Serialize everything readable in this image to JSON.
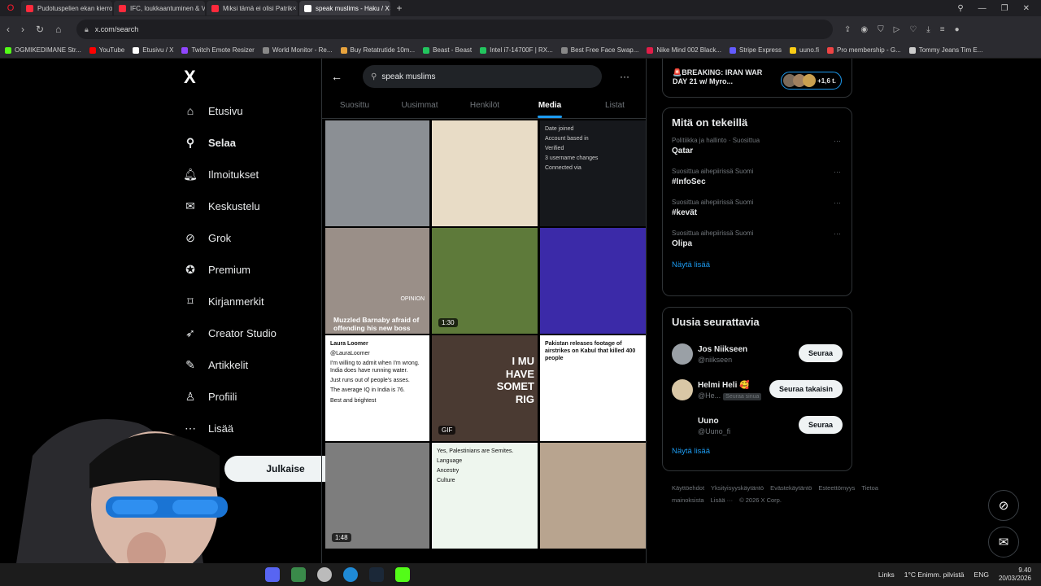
{
  "browser": {
    "tabs": [
      {
        "title": "Pudotuspelien ekan kierro",
        "color": "#ff2a3c"
      },
      {
        "title": "IFC, loukkaantuminen & V",
        "color": "#ff2a3c"
      },
      {
        "title": "Miksi tämä ei olisi Patrik",
        "color": "#ff2a3c"
      },
      {
        "title": "speak muslims - Haku / X",
        "color": "#ffffff",
        "active": true
      }
    ],
    "url": "x.com/search",
    "bookmarks": [
      {
        "label": "OGMIKEDIMANE Str...",
        "color": "#53fc18"
      },
      {
        "label": "YouTube",
        "color": "#ff0000"
      },
      {
        "label": "Etusivu / X",
        "color": "#ffffff"
      },
      {
        "label": "Twitch Emote Resizer",
        "color": "#9146ff"
      },
      {
        "label": "World Monitor - Re...",
        "color": "#888888"
      },
      {
        "label": "Buy Retatrutide 10m...",
        "color": "#e8a33d"
      },
      {
        "label": "Beast - Beast",
        "color": "#22c55e"
      },
      {
        "label": "Intel i7-14700F | RX...",
        "color": "#22c55e"
      },
      {
        "label": "Best Free Face Swap...",
        "color": "#888888"
      },
      {
        "label": "Nike Mind 002 Black...",
        "color": "#e11d48"
      },
      {
        "label": "Stripe Express",
        "color": "#635bff"
      },
      {
        "label": "uuno.fi",
        "color": "#facc15"
      },
      {
        "label": "Pro membership - G...",
        "color": "#ef4444"
      },
      {
        "label": "Tommy Jeans Tim E...",
        "color": "#cccccc"
      }
    ]
  },
  "sidebar": {
    "logo": "X",
    "items": [
      {
        "label": "Etusivu",
        "icon": "home-icon",
        "glyph": "⌂"
      },
      {
        "label": "Selaa",
        "icon": "search-icon",
        "glyph": "⚲",
        "bold": true
      },
      {
        "label": "Ilmoitukset",
        "icon": "bell-icon",
        "glyph": "🔔︎"
      },
      {
        "label": "Keskustelu",
        "icon": "mail-icon",
        "glyph": "✉"
      },
      {
        "label": "Grok",
        "icon": "grok-icon",
        "glyph": "⊘"
      },
      {
        "label": "Premium",
        "icon": "verified-icon",
        "glyph": "✪"
      },
      {
        "label": "Kirjanmerkit",
        "icon": "bookmark-icon",
        "glyph": "⌑"
      },
      {
        "label": "Creator Studio",
        "icon": "rocket-icon",
        "glyph": "➶"
      },
      {
        "label": "Artikkelit",
        "icon": "article-icon",
        "glyph": "✎"
      },
      {
        "label": "Profiili",
        "icon": "person-icon",
        "glyph": "♙"
      },
      {
        "label": "Lisää",
        "icon": "more-icon",
        "glyph": "⋯"
      }
    ],
    "post_button": "Julkaise"
  },
  "search": {
    "query": "speak muslims",
    "tabs": [
      "Suosittu",
      "Uusimmat",
      "Henkilöt",
      "Media",
      "Listat"
    ],
    "active_tab": "Media"
  },
  "media_grid": [
    {
      "kind": "photo",
      "bg": "#8b8f94",
      "caption": ""
    },
    {
      "kind": "photo",
      "bg": "#e8dcc6",
      "caption": ""
    },
    {
      "kind": "screenshot",
      "bg": "#16181c",
      "lines": [
        "Date joined",
        "Account based in",
        "Verified",
        "3 username changes",
        "Connected via"
      ]
    },
    {
      "kind": "photo",
      "bg": "#9a8f88",
      "caption": "Muzzled Barnaby afraid of offending his new boss",
      "tag": "OPINION"
    },
    {
      "kind": "video",
      "bg": "#5e7a3a",
      "duration": "1:30"
    },
    {
      "kind": "photo",
      "bg": "#3b2aa8",
      "caption": ""
    },
    {
      "kind": "tweet",
      "bg": "#ffffff",
      "lines": [
        "Laura Loomer",
        "@LauraLoomer",
        "I'm willing to admit when I'm wrong. India does have running water.",
        "Just runs out of people's asses.",
        "The average IQ in India is 76.",
        "Best and brightest"
      ]
    },
    {
      "kind": "gif",
      "bg": "#4a3a32",
      "badge": "GIF",
      "overlay": "I MU HAVE SOMET RIG"
    },
    {
      "kind": "tweet",
      "bg": "#ffffff",
      "lines": [
        "Pakistan releases footage of airstrikes on Kabul that killed 400 people"
      ]
    },
    {
      "kind": "video",
      "bg": "#7d7d7d",
      "duration": "1:48"
    },
    {
      "kind": "doc",
      "bg": "#eef6ee",
      "lines": [
        "Yes, Palestinians are Semites.",
        "Language",
        "Ancestry",
        "Culture"
      ]
    },
    {
      "kind": "photo",
      "bg": "#b8a48f",
      "caption": ""
    }
  ],
  "right": {
    "live": {
      "title": "🚨BREAKING: IRAN WAR DAY 21 w/ Myro...",
      "count": "+1,6 t."
    },
    "trending": {
      "title": "Mitä on tekeillä",
      "items": [
        {
          "context": "Politiikka ja hallinto · Suosittua",
          "name": "Qatar"
        },
        {
          "context": "Suosittua aihepiirissä Suomi",
          "name": "#InfoSec"
        },
        {
          "context": "Suosittua aihepiirissä Suomi",
          "name": "#kevät"
        },
        {
          "context": "Suosittua aihepiirissä Suomi",
          "name": "Olipa"
        }
      ],
      "show_more": "Näytä lisää"
    },
    "who_to_follow": {
      "title": "Uusia seurattavia",
      "items": [
        {
          "name": "Jos Niikseen",
          "handle": "@niikseen",
          "button": "Seuraa",
          "avatar": "#9aa0a6"
        },
        {
          "name": "Helmi Heli 🥰",
          "handle": "@He...",
          "follows_you": "Seuraa sinua",
          "button": "Seuraa takaisin",
          "avatar": "#d9c7a6"
        },
        {
          "name": "Uuno",
          "handle": "@Uuno_fi",
          "button": "Seuraa",
          "avatar": "#000000"
        }
      ],
      "show_more": "Näytä lisää"
    },
    "footer": [
      "Käyttöehdot",
      "Yksityisyyskäytäntö",
      "Evästekäytäntö",
      "Esteettömyys",
      "Tietoa mainoksista",
      "Lisää ···",
      "© 2026 X Corp."
    ]
  },
  "taskbar": {
    "links": "Links",
    "weather": "1°C  Enimm. pilvistä",
    "lang": "ENG",
    "time": "9.40",
    "date": "20/03/2026"
  }
}
